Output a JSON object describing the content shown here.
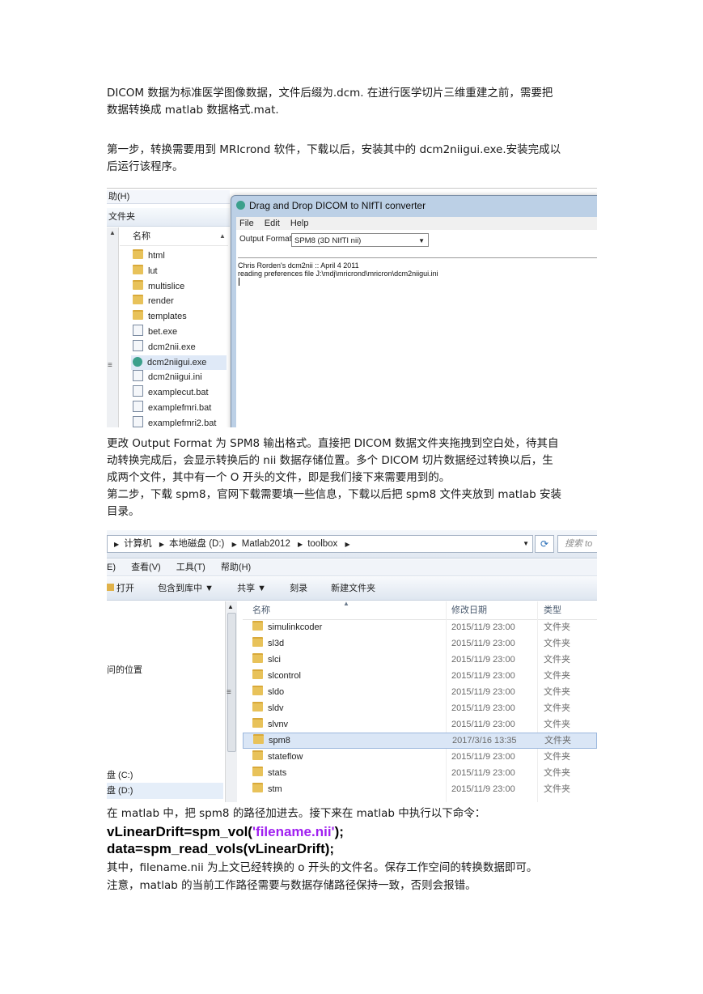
{
  "paragraphs": {
    "p1_line1": "DICOM 数据为标准医学图像数据，文件后缀为.dcm. 在进行医学切片三维重建之前，需要把",
    "p1_line2": "数据转换成 matlab 数据格式.mat.",
    "p2_line1": "第一步，转换需要用到 MRIcrond 软件，下载以后，安装其中的 dcm2niigui.exe.安装完成以",
    "p2_line2": "后运行该程序。",
    "p3_line1": "更改 Output Format  为 SPM8 输出格式。直接把 DICOM 数据文件夹拖拽到空白处，待其自",
    "p3_line2": "动转换完成后，会显示转换后的 nii 数据存储位置。多个 DICOM 切片数据经过转换以后，生",
    "p3_line3": "成两个文件，其中有一个 O 开头的文件，即是我们接下来需要用到的。",
    "p4_line1": "第二步，下载 spm8，官网下载需要填一些信息，下载以后把 spm8 文件夹放到 matlab 安装",
    "p4_line2": "目录。",
    "p5": "在 matlab 中，把 spm8 的路径加进去。接下来在 matlab 中执行以下命令：",
    "p6": "其中，filename.nii 为上文已经转换的 o 开头的文件名。保存工作空间的转换数据即可。",
    "p7": "注意，matlab 的当前工作路径需要与数据存储路径保持一致，否则会报错。"
  },
  "code": {
    "line1_pre": "vLinearDrift=spm_vol(",
    "line1_str": "'filename.nii'",
    "line1_post": ");",
    "line2": "data=spm_read_vols(vLinearDrift);"
  },
  "colors": {
    "code_string": "#a020f0"
  },
  "shot1": {
    "explorer_menu": "助(H)",
    "explorer_bar": "文件夹",
    "column_name": "名称",
    "files": [
      {
        "name": "html",
        "icon": "folder"
      },
      {
        "name": "lut",
        "icon": "folder"
      },
      {
        "name": "multislice",
        "icon": "folder"
      },
      {
        "name": "render",
        "icon": "folder"
      },
      {
        "name": "templates",
        "icon": "folder"
      },
      {
        "name": "bet.exe",
        "icon": "file"
      },
      {
        "name": "dcm2nii.exe",
        "icon": "file"
      },
      {
        "name": "dcm2niigui.exe",
        "icon": "app"
      },
      {
        "name": "dcm2niigui.ini",
        "icon": "file"
      },
      {
        "name": "examplecut.bat",
        "icon": "file"
      },
      {
        "name": "examplefmri.bat",
        "icon": "file"
      },
      {
        "name": "examplefmri2.bat",
        "icon": "file"
      }
    ],
    "window_title": "Drag and Drop DICOM to NIfTI converter",
    "menu": [
      "File",
      "Edit",
      "Help"
    ],
    "output_format_label": "Output Format",
    "output_format_value": "SPM8 (3D NIfTI nii)",
    "log_line1": "Chris Rorden's dcm2nii :: April 4 2011",
    "log_line2": "reading preferences file J:\\mdj\\mricrond\\mricron\\dcm2niigui.ini"
  },
  "shot2": {
    "breadcrumb": [
      "计算机",
      "本地磁盘 (D:)",
      "Matlab2012",
      "toolbox"
    ],
    "search_placeholder": "搜索 to",
    "menu": [
      "E)",
      "查看(V)",
      "工具(T)",
      "帮助(H)"
    ],
    "toolbar": [
      "打开",
      "包含到库中 ▼",
      "共享 ▼",
      "刻录",
      "新建文件夹"
    ],
    "nav_items": [
      "问的位置",
      "盘 (C:)",
      "盘 (D:)"
    ],
    "columns": [
      "名称",
      "修改日期",
      "类型"
    ],
    "rows": [
      {
        "name": "simulinkcoder",
        "date": "2015/11/9 23:00",
        "type": "文件夹"
      },
      {
        "name": "sl3d",
        "date": "2015/11/9 23:00",
        "type": "文件夹"
      },
      {
        "name": "slci",
        "date": "2015/11/9 23:00",
        "type": "文件夹"
      },
      {
        "name": "slcontrol",
        "date": "2015/11/9 23:00",
        "type": "文件夹"
      },
      {
        "name": "sldo",
        "date": "2015/11/9 23:00",
        "type": "文件夹"
      },
      {
        "name": "sldv",
        "date": "2015/11/9 23:00",
        "type": "文件夹"
      },
      {
        "name": "slvnv",
        "date": "2015/11/9 23:00",
        "type": "文件夹"
      },
      {
        "name": "spm8",
        "date": "2017/3/16 13:35",
        "type": "文件夹"
      },
      {
        "name": "stateflow",
        "date": "2015/11/9 23:00",
        "type": "文件夹"
      },
      {
        "name": "stats",
        "date": "2015/11/9 23:00",
        "type": "文件夹"
      },
      {
        "name": "stm",
        "date": "2015/11/9 23:00",
        "type": "文件夹"
      }
    ]
  }
}
